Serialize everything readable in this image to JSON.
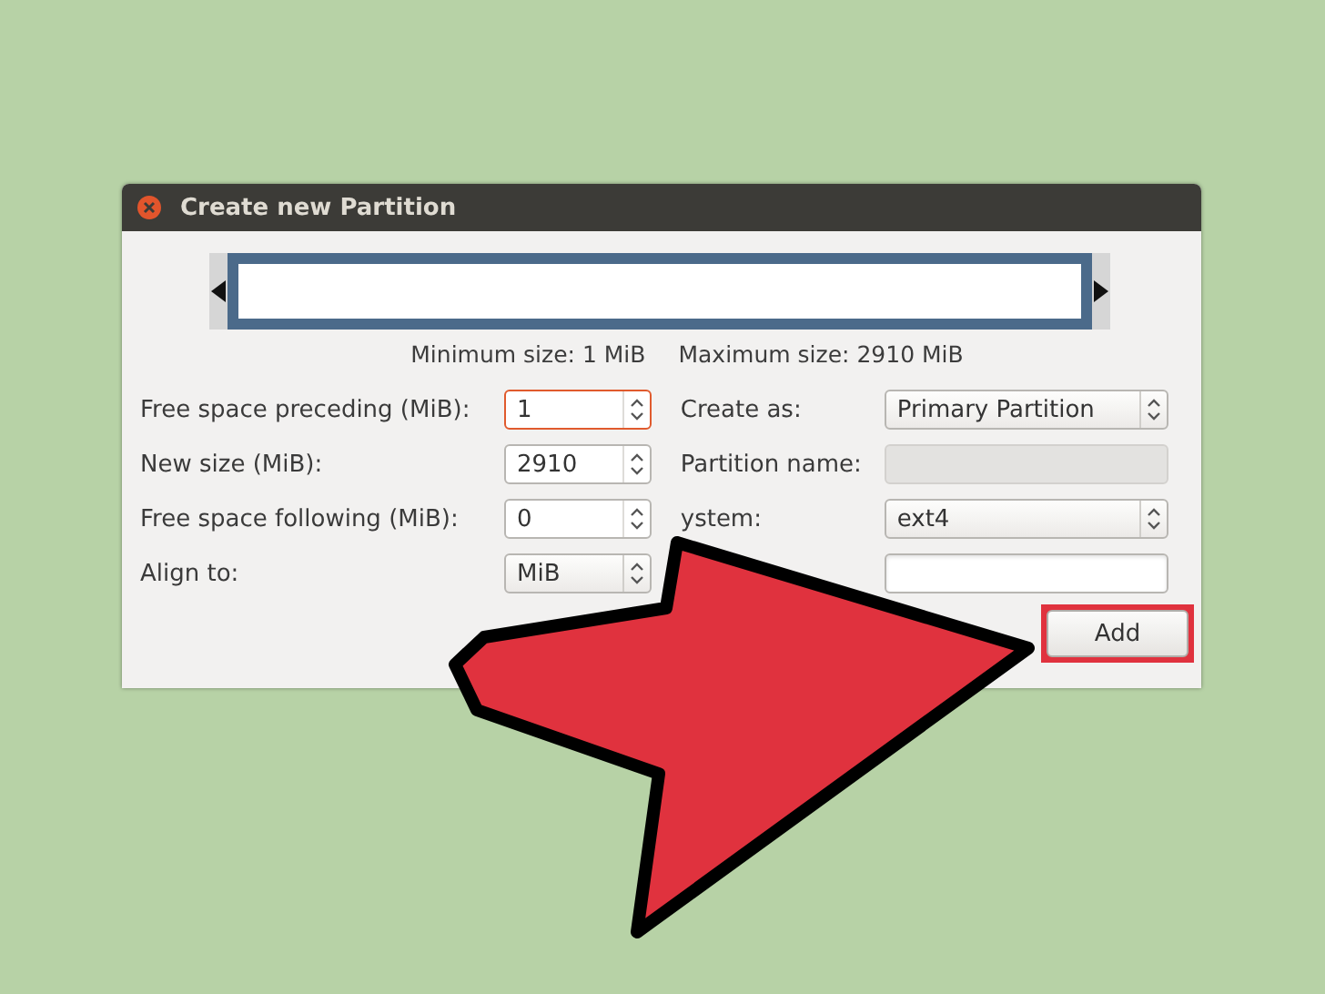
{
  "window": {
    "title": "Create new Partition"
  },
  "size_info": {
    "minimum": "Minimum size: 1 MiB",
    "maximum": "Maximum size: 2910 MiB"
  },
  "left_fields": [
    {
      "label": "Free space preceding (MiB):",
      "kind": "spin",
      "value": "1",
      "focused": true
    },
    {
      "label": "New size (MiB):",
      "kind": "spin",
      "value": "2910",
      "focused": false
    },
    {
      "label": "Free space following (MiB):",
      "kind": "spin",
      "value": "0",
      "focused": false
    },
    {
      "label": "Align to:",
      "kind": "combo",
      "value": "MiB",
      "focused": false
    }
  ],
  "right_fields": [
    {
      "label": "Create as:",
      "kind": "combo",
      "value": "Primary Partition",
      "disabled": false
    },
    {
      "label": "Partition name:",
      "kind": "entry",
      "disabled": true
    },
    {
      "label": "ystem:",
      "kind": "combo",
      "value": "ext4",
      "disabled": false
    },
    {
      "kind": "entry",
      "disabled": false
    }
  ],
  "buttons": [
    {
      "label": "Add",
      "highlighted": true
    }
  ]
}
